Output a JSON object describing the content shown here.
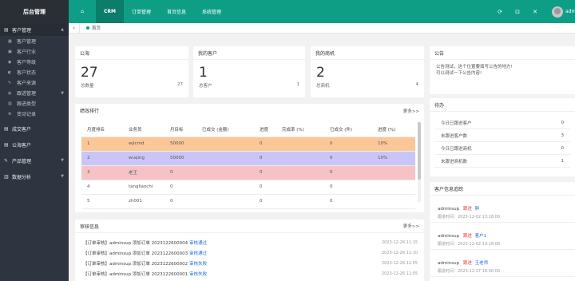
{
  "brand": "后台管理",
  "topnav": {
    "home_icon": "home-icon",
    "items": [
      {
        "label": "CRM",
        "active": true
      },
      {
        "label": "订单管理",
        "active": false
      },
      {
        "label": "首页信息",
        "active": false
      },
      {
        "label": "系统管理",
        "active": false
      }
    ]
  },
  "topright": {
    "icons": [
      "refresh-icon",
      "lock-icon",
      "fullscreen-icon"
    ],
    "username": "admin"
  },
  "sidebar": {
    "groups": [
      {
        "label": "客户管理",
        "icon": "customer-icon",
        "open": true,
        "items": [
          {
            "label": "客户管理",
            "icon": "list-icon",
            "has_children": false
          },
          {
            "label": "客户行业",
            "icon": "industry-icon",
            "has_children": false
          },
          {
            "label": "客户等级",
            "icon": "level-icon",
            "has_children": false
          },
          {
            "label": "客户状态",
            "icon": "status-icon",
            "has_children": false
          },
          {
            "label": "客户来源",
            "icon": "source-icon",
            "has_children": false
          },
          {
            "label": "跟进管理",
            "icon": "follow-icon",
            "has_children": true
          },
          {
            "label": "跟进类型",
            "icon": "type-icon",
            "has_children": false
          },
          {
            "label": "变动记录",
            "icon": "history-icon",
            "has_children": false
          }
        ]
      },
      {
        "label": "成交客户",
        "icon": "deal-icon",
        "open": false,
        "items": []
      },
      {
        "label": "公海客户",
        "icon": "sea-icon",
        "open": false,
        "items": []
      },
      {
        "label": "产品管理",
        "icon": "product-icon",
        "open": false,
        "items": []
      },
      {
        "label": "数据分析",
        "icon": "analysis-icon",
        "open": false,
        "items": []
      }
    ]
  },
  "tabs": {
    "back_icon": "chevron-left-icon",
    "home_label": "首页"
  },
  "stats": [
    {
      "title": "公海",
      "value": "27",
      "foot_label": "总数量",
      "foot_value": "27"
    },
    {
      "title": "我的客户",
      "value": "1",
      "foot_label": "总客户",
      "foot_value": "1"
    },
    {
      "title": "我的商机",
      "value": "2",
      "foot_label": "总商机",
      "foot_value": "4"
    }
  ],
  "rank": {
    "title": "绩效排行",
    "more": "更多>>",
    "headers": [
      "月度排名",
      "业务员",
      "月目标",
      "已成交 (金额)",
      "进度",
      "完成率 (%)",
      "已成交 (件)",
      "进度 (%)"
    ],
    "rows": [
      [
        "1",
        "wjlcmd",
        "50000",
        "",
        "0",
        "",
        "0",
        "10%"
      ],
      [
        "2",
        "wuqing",
        "50000",
        "",
        "0",
        "",
        "0",
        "10%"
      ],
      [
        "3",
        "老王",
        "0",
        "",
        "0",
        "",
        "0",
        ""
      ],
      [
        "4",
        "tangliaochi",
        "0",
        "",
        "0",
        "",
        "0",
        ""
      ],
      [
        "5",
        "zh001",
        "0",
        "",
        "0",
        "",
        "0",
        ""
      ]
    ]
  },
  "review": {
    "title": "审核信息",
    "more": "更多>>",
    "items": [
      {
        "text": "【订单审核】adminsup 添加订单 2023122600004",
        "status": "审核通过",
        "time": "2023-12-26 11:15"
      },
      {
        "text": "【订单审核】adminsup 添加订单 2023122600003",
        "status": "审核通过",
        "time": "2023-12-26 11:10"
      },
      {
        "text": "【订单审核】adminsup 添加订单 2023122600002",
        "status": "审核失败",
        "time": "2023-12-26 11:05"
      },
      {
        "text": "【订单审核】adminsup 添加订单 2023122600001",
        "status": "审核失败",
        "time": "2023-12-26 11:05"
      }
    ]
  },
  "notice": {
    "title": "公告",
    "lines": [
      "公告测试，这个位置要填写公告的地方!",
      "可以测试一下公告内容!"
    ]
  },
  "todo": {
    "title": "待办",
    "rows": [
      {
        "label": "今日已跟进客户",
        "value": "0"
      },
      {
        "label": "未跟进客户数",
        "value": "3"
      },
      {
        "label": "今日已跟进商机",
        "value": "0"
      },
      {
        "label": "未跟进商机数",
        "value": "1"
      }
    ]
  },
  "follow": {
    "title": "客户信息追踪",
    "items": [
      {
        "user": "adminsup",
        "verb": "跟进",
        "target": "胖",
        "time": "跟进时间：2023-12-02 13:18:00"
      },
      {
        "user": "adminsup",
        "verb": "跟进",
        "target": "客户1",
        "time": "跟进时间：2023-12-02 13:18:00"
      },
      {
        "user": "adminsup",
        "verb": "跟进",
        "target": "王老师",
        "time": "跟进时间：2023-12-27 18:00:00"
      }
    ]
  }
}
